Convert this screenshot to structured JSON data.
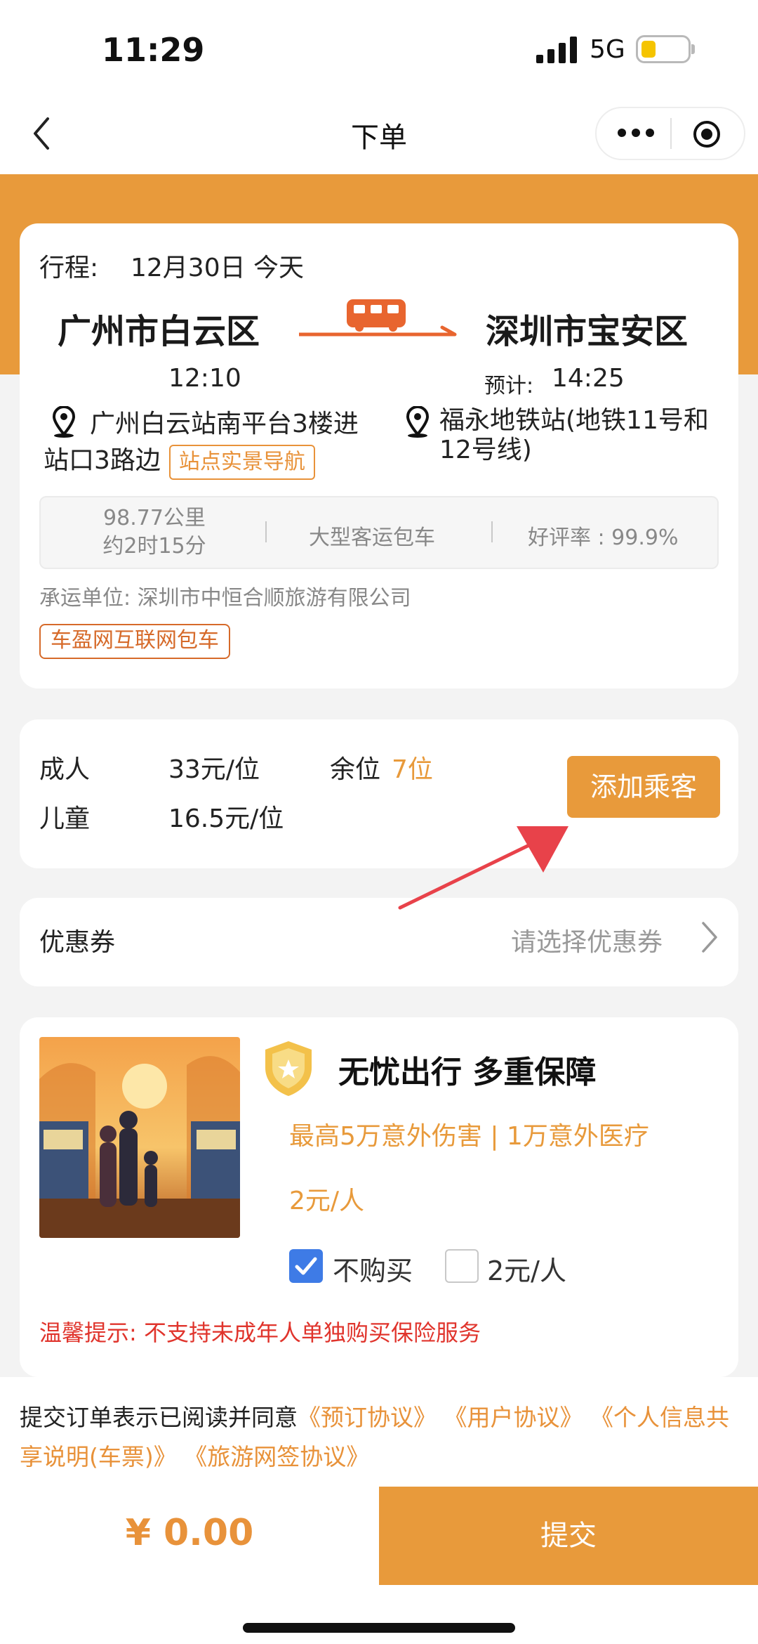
{
  "status_bar": {
    "time": "11:29",
    "network": "5G"
  },
  "nav": {
    "title": "下单"
  },
  "trip": {
    "date_label": "行程:",
    "date": "12月30日 今天",
    "from_city": "广州市白云区",
    "to_city": "深圳市宝安区",
    "departure_time": "12:10",
    "arrival_label": "预计:",
    "arrival_time": "14:25",
    "from_station": "广州白云站南平台3楼进站口3路边",
    "to_station": "福永地铁站(地铁11号和12号线)",
    "nav_chip": "站点实景导航",
    "distance": "98.77公里",
    "duration": "约2时15分",
    "vehicle_type": "大型客运包车",
    "rating": "好评率 : 99.9%",
    "carrier": "承运单位:  深圳市中恒合顺旅游有限公司",
    "platform_badge": "车盈网互联网包车"
  },
  "fare": {
    "adult_label": "成人",
    "adult_price": "33元/位",
    "child_label": "儿童",
    "child_price": "16.5元/位",
    "seats_label": "余位",
    "seats_value": "7位",
    "add_passenger": "添加乘客"
  },
  "coupon": {
    "label": "优惠券",
    "hint": "请选择优惠券"
  },
  "insurance": {
    "title": "无忧出行  多重保障",
    "coverage": "最高5万意外伤害 | 1万意外医疗",
    "price": "2元/人",
    "option_no": "不购买",
    "option_yes": "2元/人",
    "option_no_checked": true,
    "tip": "温馨提示:  不支持未成年人单独购买保险服务"
  },
  "agreement": {
    "prefix": "提交订单表示已阅读并同意",
    "links": [
      "《预订协议》",
      "《用户协议》",
      "《个人信息共享说明(车票)》",
      "《旅游网签协议》"
    ]
  },
  "bottom": {
    "total": "¥ 0.00",
    "submit": "提交"
  },
  "colors": {
    "accent": "#e89a3b",
    "link": "#e8923a",
    "tip": "#e0342c",
    "checkbox": "#3e7be6"
  }
}
